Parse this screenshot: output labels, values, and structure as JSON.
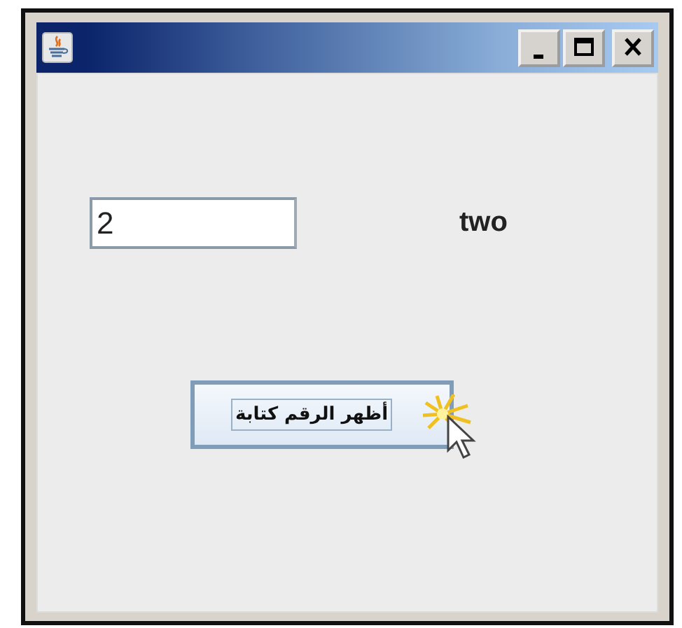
{
  "text_field": {
    "value": "2"
  },
  "result_label": "two",
  "button": {
    "label": "أظهر الرقم كتابة",
    "focused": true
  }
}
